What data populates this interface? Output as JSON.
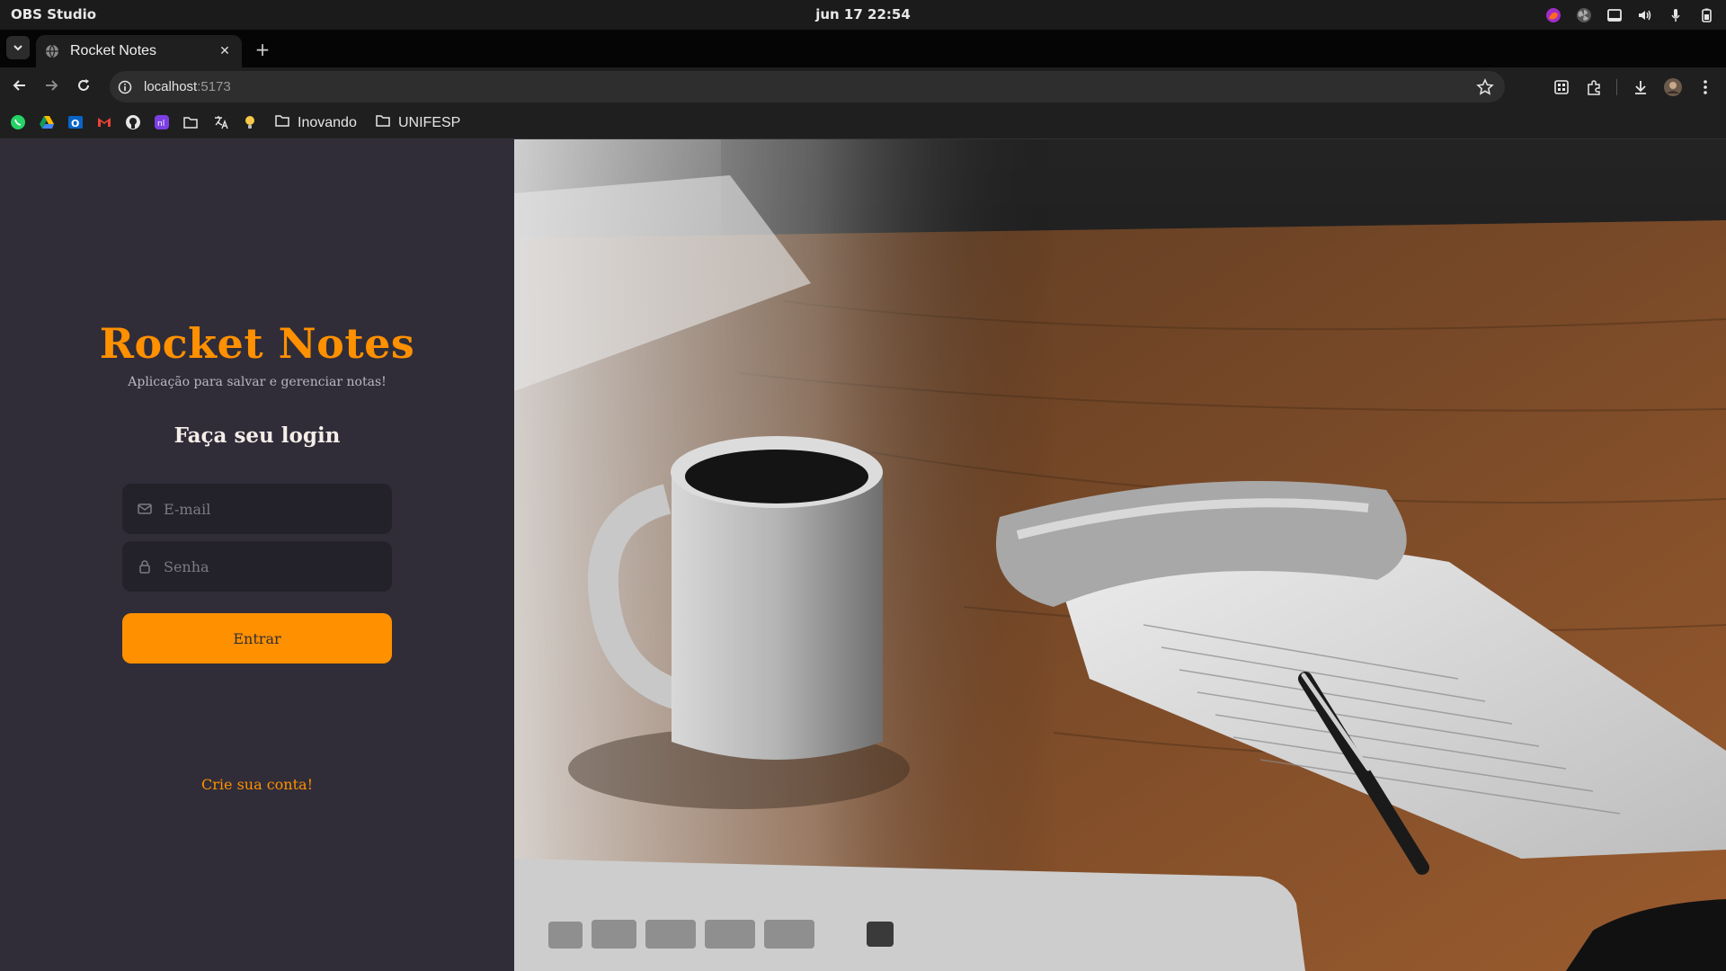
{
  "os": {
    "app_name": "OBS Studio",
    "clock": "jun 17  22:54",
    "tray_icons": [
      "firefox-icon",
      "fan-icon",
      "window-icon",
      "volume-icon",
      "microphone-icon",
      "battery-icon"
    ]
  },
  "browser": {
    "tab": {
      "title": "Rocket Notes",
      "favicon": "globe-icon"
    },
    "address": {
      "host": "localhost",
      "port": ":5173"
    },
    "bookmarks": {
      "icons": [
        "whatsapp-icon",
        "google-drive-icon",
        "outlook-icon",
        "gmail-icon",
        "github-icon",
        "app-icon",
        "folder-icon",
        "translate-icon",
        "bulb-icon"
      ],
      "folders": [
        "Inovando",
        "UNIFESP"
      ]
    }
  },
  "page": {
    "brand_title": "Rocket Notes",
    "brand_subtitle": "Aplicação para salvar e gerenciar notas!",
    "login_title": "Faça seu login",
    "email_placeholder": "E-mail",
    "password_placeholder": "Senha",
    "enter_button": "Entrar",
    "create_account": "Crie sua conta!"
  },
  "colors": {
    "accent": "#ff9000",
    "panel_bg": "#302d39",
    "input_bg": "#232129",
    "heading": "#f4ede8"
  }
}
